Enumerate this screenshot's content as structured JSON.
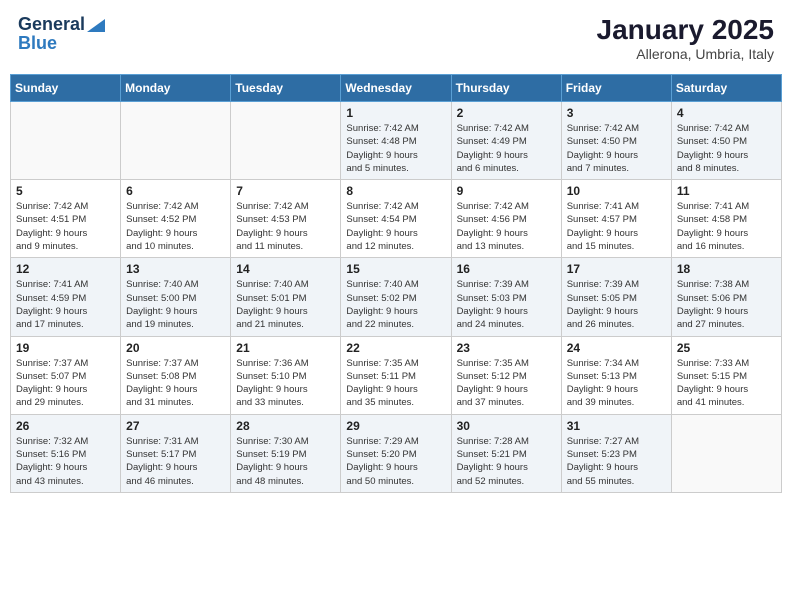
{
  "header": {
    "logo_general": "General",
    "logo_blue": "Blue",
    "month_year": "January 2025",
    "location": "Allerona, Umbria, Italy"
  },
  "calendar": {
    "weekdays": [
      "Sunday",
      "Monday",
      "Tuesday",
      "Wednesday",
      "Thursday",
      "Friday",
      "Saturday"
    ],
    "weeks": [
      [
        {
          "day": "",
          "info": ""
        },
        {
          "day": "",
          "info": ""
        },
        {
          "day": "",
          "info": ""
        },
        {
          "day": "1",
          "info": "Sunrise: 7:42 AM\nSunset: 4:48 PM\nDaylight: 9 hours\nand 5 minutes."
        },
        {
          "day": "2",
          "info": "Sunrise: 7:42 AM\nSunset: 4:49 PM\nDaylight: 9 hours\nand 6 minutes."
        },
        {
          "day": "3",
          "info": "Sunrise: 7:42 AM\nSunset: 4:50 PM\nDaylight: 9 hours\nand 7 minutes."
        },
        {
          "day": "4",
          "info": "Sunrise: 7:42 AM\nSunset: 4:50 PM\nDaylight: 9 hours\nand 8 minutes."
        }
      ],
      [
        {
          "day": "5",
          "info": "Sunrise: 7:42 AM\nSunset: 4:51 PM\nDaylight: 9 hours\nand 9 minutes."
        },
        {
          "day": "6",
          "info": "Sunrise: 7:42 AM\nSunset: 4:52 PM\nDaylight: 9 hours\nand 10 minutes."
        },
        {
          "day": "7",
          "info": "Sunrise: 7:42 AM\nSunset: 4:53 PM\nDaylight: 9 hours\nand 11 minutes."
        },
        {
          "day": "8",
          "info": "Sunrise: 7:42 AM\nSunset: 4:54 PM\nDaylight: 9 hours\nand 12 minutes."
        },
        {
          "day": "9",
          "info": "Sunrise: 7:42 AM\nSunset: 4:56 PM\nDaylight: 9 hours\nand 13 minutes."
        },
        {
          "day": "10",
          "info": "Sunrise: 7:41 AM\nSunset: 4:57 PM\nDaylight: 9 hours\nand 15 minutes."
        },
        {
          "day": "11",
          "info": "Sunrise: 7:41 AM\nSunset: 4:58 PM\nDaylight: 9 hours\nand 16 minutes."
        }
      ],
      [
        {
          "day": "12",
          "info": "Sunrise: 7:41 AM\nSunset: 4:59 PM\nDaylight: 9 hours\nand 17 minutes."
        },
        {
          "day": "13",
          "info": "Sunrise: 7:40 AM\nSunset: 5:00 PM\nDaylight: 9 hours\nand 19 minutes."
        },
        {
          "day": "14",
          "info": "Sunrise: 7:40 AM\nSunset: 5:01 PM\nDaylight: 9 hours\nand 21 minutes."
        },
        {
          "day": "15",
          "info": "Sunrise: 7:40 AM\nSunset: 5:02 PM\nDaylight: 9 hours\nand 22 minutes."
        },
        {
          "day": "16",
          "info": "Sunrise: 7:39 AM\nSunset: 5:03 PM\nDaylight: 9 hours\nand 24 minutes."
        },
        {
          "day": "17",
          "info": "Sunrise: 7:39 AM\nSunset: 5:05 PM\nDaylight: 9 hours\nand 26 minutes."
        },
        {
          "day": "18",
          "info": "Sunrise: 7:38 AM\nSunset: 5:06 PM\nDaylight: 9 hours\nand 27 minutes."
        }
      ],
      [
        {
          "day": "19",
          "info": "Sunrise: 7:37 AM\nSunset: 5:07 PM\nDaylight: 9 hours\nand 29 minutes."
        },
        {
          "day": "20",
          "info": "Sunrise: 7:37 AM\nSunset: 5:08 PM\nDaylight: 9 hours\nand 31 minutes."
        },
        {
          "day": "21",
          "info": "Sunrise: 7:36 AM\nSunset: 5:10 PM\nDaylight: 9 hours\nand 33 minutes."
        },
        {
          "day": "22",
          "info": "Sunrise: 7:35 AM\nSunset: 5:11 PM\nDaylight: 9 hours\nand 35 minutes."
        },
        {
          "day": "23",
          "info": "Sunrise: 7:35 AM\nSunset: 5:12 PM\nDaylight: 9 hours\nand 37 minutes."
        },
        {
          "day": "24",
          "info": "Sunrise: 7:34 AM\nSunset: 5:13 PM\nDaylight: 9 hours\nand 39 minutes."
        },
        {
          "day": "25",
          "info": "Sunrise: 7:33 AM\nSunset: 5:15 PM\nDaylight: 9 hours\nand 41 minutes."
        }
      ],
      [
        {
          "day": "26",
          "info": "Sunrise: 7:32 AM\nSunset: 5:16 PM\nDaylight: 9 hours\nand 43 minutes."
        },
        {
          "day": "27",
          "info": "Sunrise: 7:31 AM\nSunset: 5:17 PM\nDaylight: 9 hours\nand 46 minutes."
        },
        {
          "day": "28",
          "info": "Sunrise: 7:30 AM\nSunset: 5:19 PM\nDaylight: 9 hours\nand 48 minutes."
        },
        {
          "day": "29",
          "info": "Sunrise: 7:29 AM\nSunset: 5:20 PM\nDaylight: 9 hours\nand 50 minutes."
        },
        {
          "day": "30",
          "info": "Sunrise: 7:28 AM\nSunset: 5:21 PM\nDaylight: 9 hours\nand 52 minutes."
        },
        {
          "day": "31",
          "info": "Sunrise: 7:27 AM\nSunset: 5:23 PM\nDaylight: 9 hours\nand 55 minutes."
        },
        {
          "day": "",
          "info": ""
        }
      ]
    ]
  }
}
